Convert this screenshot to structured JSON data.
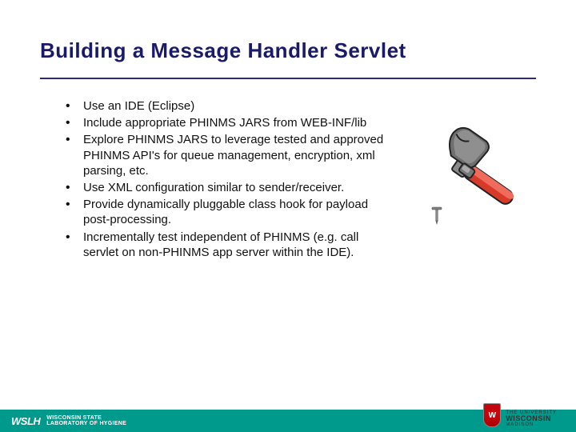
{
  "slide": {
    "title": "Building a Message Handler Servlet",
    "bullets": [
      "Use an IDE (Eclipse)",
      "Include appropriate PHINMS JARS from WEB-INF/lib",
      "Explore PHINMS JARS to leverage tested and approved PHINMS API's for queue management, encryption, xml parsing, etc.",
      "Use XML configuration similar to sender/receiver.",
      "Provide dynamically pluggable class hook for payload post-processing.",
      "Incrementally test independent of PHINMS (e.g. call servlet on non-PHINMS app server within the IDE)."
    ]
  },
  "footer": {
    "left_mark": "WSLH",
    "left_line1": "WISCONSIN STATE",
    "left_line2": "LABORATORY OF HYGIENE",
    "right_line1": "THE UNIVERSITY",
    "right_line2": "WISCONSIN",
    "right_line3": "MADISON",
    "crest_letter": "W"
  },
  "graphic": {
    "name": "hammer-and-nail"
  },
  "colors": {
    "title": "#1a1a6a",
    "footer_bg": "#009a8c",
    "hammer_handle": "#d83a2a",
    "hammer_head": "#696969"
  }
}
